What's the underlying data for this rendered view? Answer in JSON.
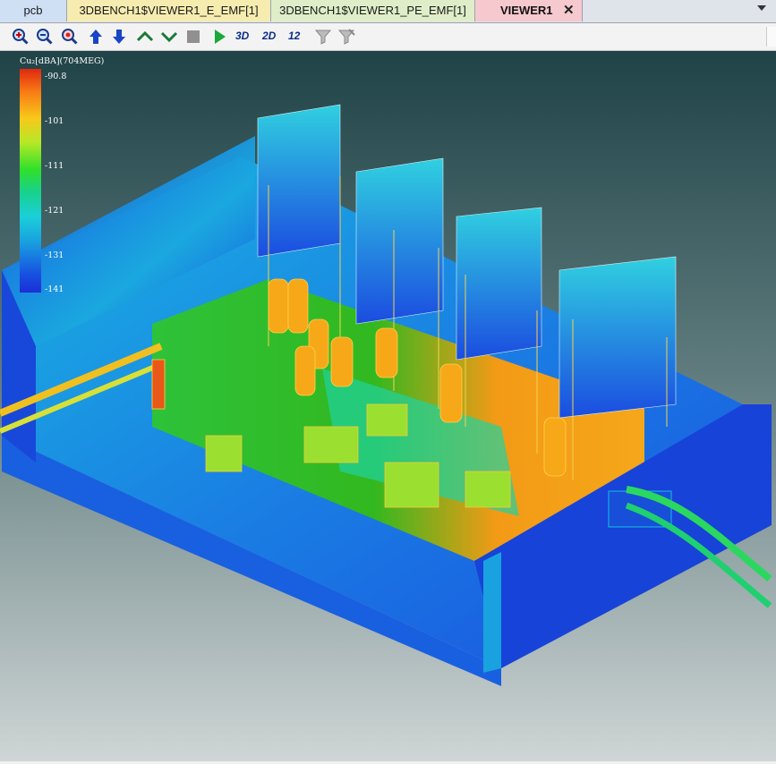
{
  "tabs": [
    {
      "label": "pcb"
    },
    {
      "label": "3DBENCH1$VIEWER1_E_EMF[1]"
    },
    {
      "label": "3DBENCH1$VIEWER1_PE_EMF[1]"
    },
    {
      "label": "VIEWER1",
      "close_icon": "✕"
    }
  ],
  "toolbar": {
    "items": [
      {
        "name": "zoom-in-icon"
      },
      {
        "name": "zoom-out-icon"
      },
      {
        "name": "zoom-reset-icon"
      },
      {
        "name": "arrow-up-icon"
      },
      {
        "name": "arrow-down-icon"
      },
      {
        "name": "chevron-up-icon"
      },
      {
        "name": "chevron-down-icon"
      },
      {
        "name": "stop-icon"
      },
      {
        "name": "play-icon"
      },
      {
        "name": "view-3d-icon",
        "label": "3D"
      },
      {
        "name": "view-2d-icon",
        "label": "2D"
      },
      {
        "name": "view-12-icon",
        "label": "12"
      },
      {
        "name": "filter-icon"
      },
      {
        "name": "filter-clear-icon"
      }
    ],
    "accent_color": "#0b2e8a"
  },
  "legend": {
    "title": "Cu₂[dBA](704MEG)",
    "ticks": [
      "-90.8",
      "-101",
      "-111",
      "-121",
      "-131",
      "-141"
    ],
    "colors": [
      "#e02810",
      "#f77a14",
      "#f8c81a",
      "#30e02a",
      "#1ad0d8",
      "#1750e0"
    ]
  }
}
